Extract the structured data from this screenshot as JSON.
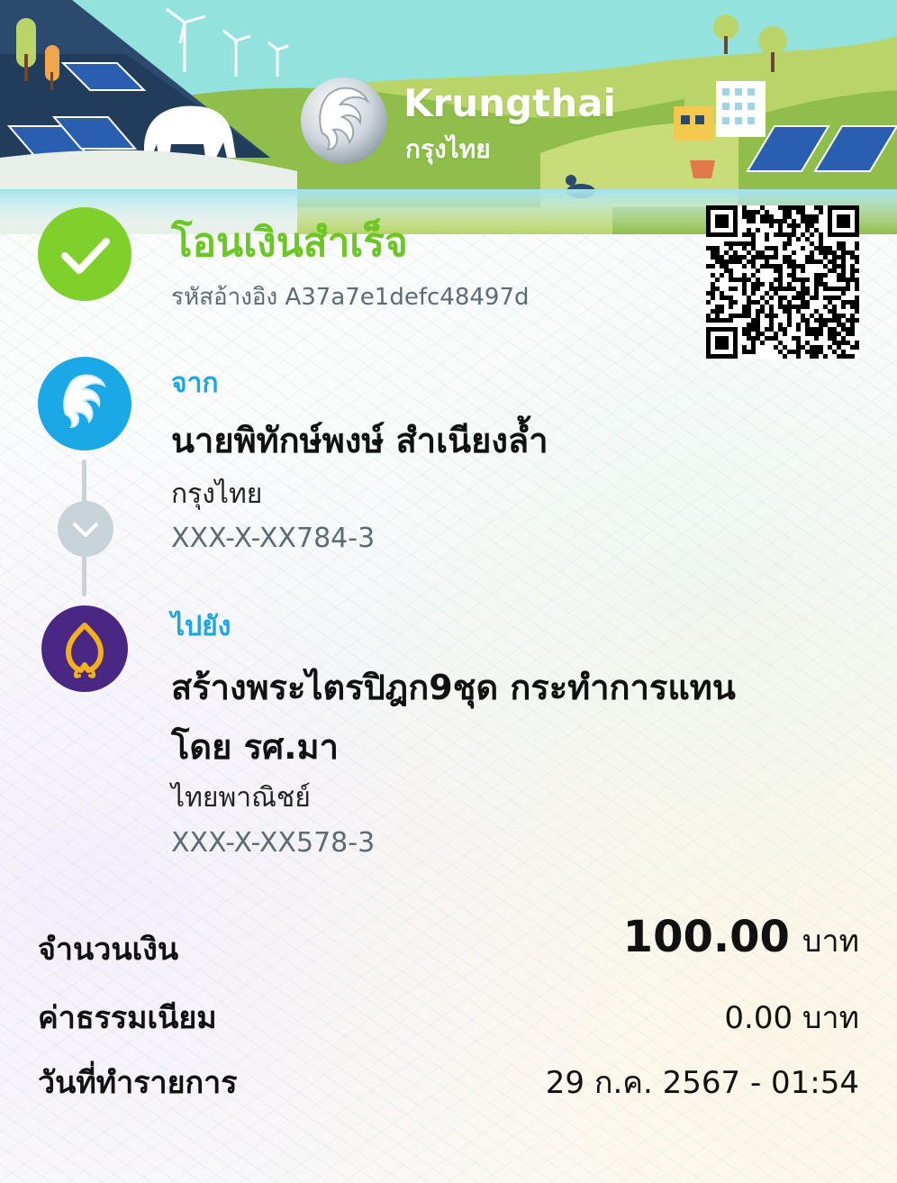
{
  "header": {
    "brand_en": "Krungthai",
    "brand_th": "กรุงไทย"
  },
  "status": {
    "title": "โอนเงินสำเร็จ",
    "ref_label": "รหัสอ้างอิง",
    "ref_code": "A37a7e1defc48497d",
    "ref_line": "รหัสอ้างอิง A37a7e1defc48497d"
  },
  "from": {
    "label": "จาก",
    "name": "นายพิทักษ์พงษ์ สำเนียงล้ำ",
    "bank": "กรุงไทย",
    "account": "XXX-X-XX784-3"
  },
  "to": {
    "label": "ไปยัง",
    "name_line1": "สร้างพระไตรปิฎก9ชุด กระทำการแทน",
    "name_line2": "โดย รศ.มา",
    "bank": "ไทยพาณิชย์",
    "account": "XXX-X-XX578-3"
  },
  "summary": {
    "amount_label": "จำนวนเงิน",
    "amount_value": "100.00",
    "amount_unit": "บาท",
    "fee_label": "ค่าธรรมเนียม",
    "fee_value": "0.00 บาท",
    "date_label": "วันที่ทำรายการ",
    "date_value": "29 ก.ค. 2567 - 01:54"
  },
  "colors": {
    "success_green": "#6cc623",
    "krungthai_blue": "#1ba8e6",
    "scb_purple": "#4a2782",
    "scb_gold": "#f2b01e"
  }
}
